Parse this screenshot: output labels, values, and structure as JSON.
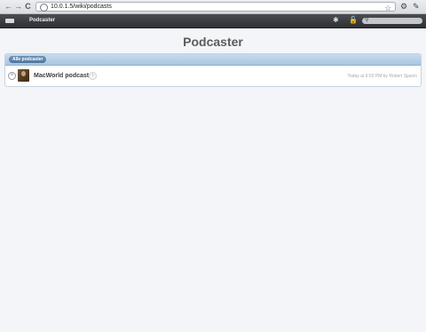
{
  "browser": {
    "url": "10.0.1.5/wiki/podcasts",
    "back_icon": "←",
    "forward_icon": "→",
    "reload_icon": "C",
    "star_icon": "☆",
    "page_icon": "⚙",
    "wrench_icon": "✎"
  },
  "wiki_header": {
    "title": "Podcaster",
    "gear_icon": "✱",
    "lock_icon": "🔓",
    "search_icon": "⚲"
  },
  "page": {
    "title": "Podcaster"
  },
  "panel": {
    "tag_label": "Alle podcaster",
    "items": [
      {
        "title": "MacWorld podcast",
        "info": "i",
        "close": "×",
        "meta": "Today at 9:03 PM by Robert Sjason"
      }
    ]
  }
}
